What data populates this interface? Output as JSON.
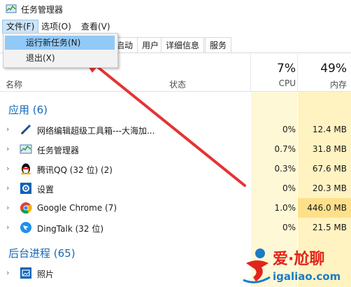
{
  "window": {
    "title": "任务管理器"
  },
  "menu": {
    "file": "文件(F)",
    "options": "选项(O)",
    "view": "查看(V)"
  },
  "file_menu": {
    "run_new_task": "运行新任务(N)",
    "exit": "退出(X)"
  },
  "tabs": [
    "启动",
    "用户",
    "详细信息",
    "服务"
  ],
  "columns": {
    "name": "名称",
    "status": "状态",
    "cpu_pct": "7%",
    "cpu_label": "CPU",
    "mem_pct": "49%",
    "mem_label": "内存"
  },
  "groups": {
    "apps": "应用 (6)",
    "background": "后台进程 (65)"
  },
  "apps": [
    {
      "name": "网络编辑超级工具箱---大海加...",
      "cpu": "0%",
      "mem": "12.4 MB",
      "icon": "pen-icon"
    },
    {
      "name": "任务管理器",
      "cpu": "0.7%",
      "mem": "31.8 MB",
      "icon": "task-manager-icon"
    },
    {
      "name": "腾讯QQ (32 位) (2)",
      "cpu": "0.3%",
      "mem": "67.6 MB",
      "icon": "qq-penguin-icon"
    },
    {
      "name": "设置",
      "cpu": "0%",
      "mem": "20.3 MB",
      "icon": "gear-icon"
    },
    {
      "name": "Google Chrome (7)",
      "cpu": "1.0%",
      "mem": "446.0 MB",
      "icon": "chrome-icon"
    },
    {
      "name": "DingTalk (32 位)",
      "cpu": "0%",
      "mem": "21.5 MB",
      "icon": "dingtalk-icon"
    }
  ],
  "background": [
    {
      "name": "照片",
      "icon": "photos-icon"
    }
  ],
  "watermark": {
    "brand": "爱·尬聊",
    "url": "igaliao.com"
  },
  "colors": {
    "accent_blue": "#1668b8",
    "cpu_col_bg": "#fff8d6",
    "mem_col_bg": "#fff3c2",
    "mem_high_bg": "#ffe08a",
    "menu_highlight": "#91c9f7",
    "arrow_red": "#e53333"
  }
}
